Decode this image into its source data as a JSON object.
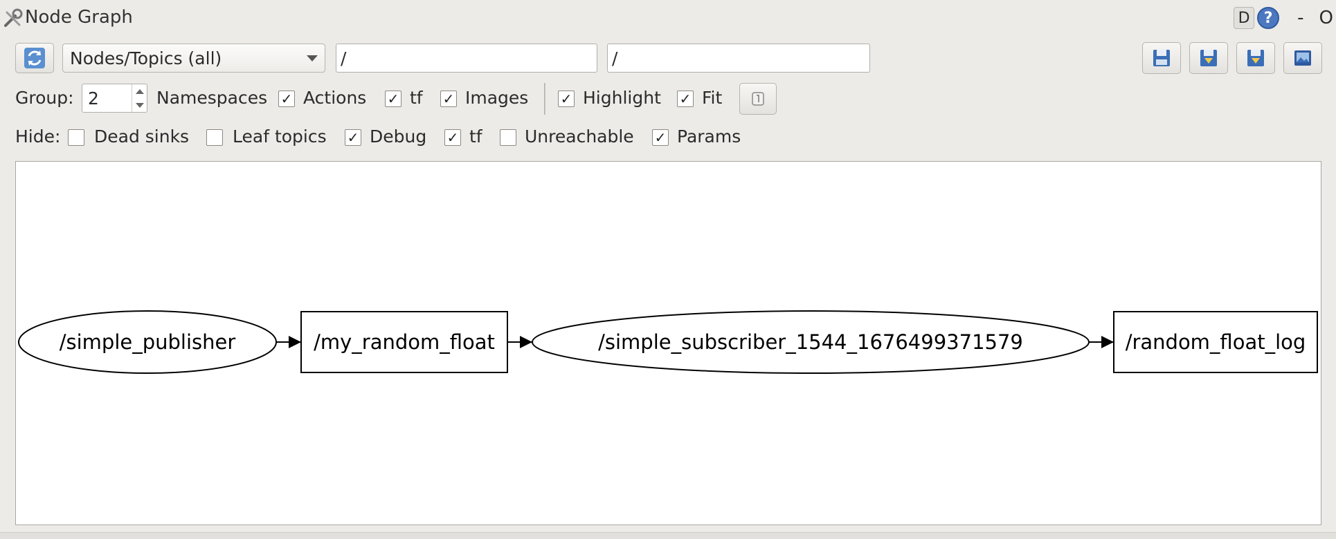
{
  "window": {
    "title": "Node Graph",
    "d_label": "D",
    "help_label": "?",
    "minimize_label": "-",
    "close_label": "O"
  },
  "toolbar": {
    "view_mode": "Nodes/Topics (all)",
    "node_filter": "/",
    "topic_filter": "/"
  },
  "options_row": {
    "group_label": "Group:",
    "group_value": "2",
    "namespaces_label": "Namespaces",
    "actions": {
      "label": "Actions",
      "checked": true
    },
    "tf": {
      "label": "tf",
      "checked": true
    },
    "images": {
      "label": "Images",
      "checked": true
    },
    "highlight": {
      "label": "Highlight",
      "checked": true
    },
    "fit": {
      "label": "Fit",
      "checked": true
    }
  },
  "hide_row": {
    "hide_label": "Hide:",
    "dead_sinks": {
      "label": "Dead sinks",
      "checked": false
    },
    "leaf_topics": {
      "label": "Leaf topics",
      "checked": false
    },
    "debug": {
      "label": "Debug",
      "checked": true
    },
    "tf": {
      "label": "tf",
      "checked": true
    },
    "unreachable": {
      "label": "Unreachable",
      "checked": false
    },
    "params": {
      "label": "Params",
      "checked": true
    }
  },
  "graph": {
    "nodes": [
      {
        "id": "simple_publisher",
        "label": "/simple_publisher",
        "shape": "ellipse"
      },
      {
        "id": "my_random_float",
        "label": "/my_random_float",
        "shape": "box"
      },
      {
        "id": "simple_subscriber",
        "label": "/simple_subscriber_1544_1676499371579",
        "shape": "ellipse"
      },
      {
        "id": "random_float_log",
        "label": "/random_float_log",
        "shape": "box"
      }
    ],
    "edges": [
      {
        "from": "simple_publisher",
        "to": "my_random_float"
      },
      {
        "from": "my_random_float",
        "to": "simple_subscriber"
      },
      {
        "from": "simple_subscriber",
        "to": "random_float_log"
      }
    ]
  },
  "colors": {
    "accent_blue": "#4c78c0",
    "background": "#edebe8"
  },
  "icons": {
    "refresh": "refresh-icon",
    "load": "load-dot-icon",
    "save_dot": "save-dot-icon",
    "save_svg": "save-svg-icon",
    "save_image": "save-image-icon",
    "fit_view": "fit-view-icon"
  }
}
